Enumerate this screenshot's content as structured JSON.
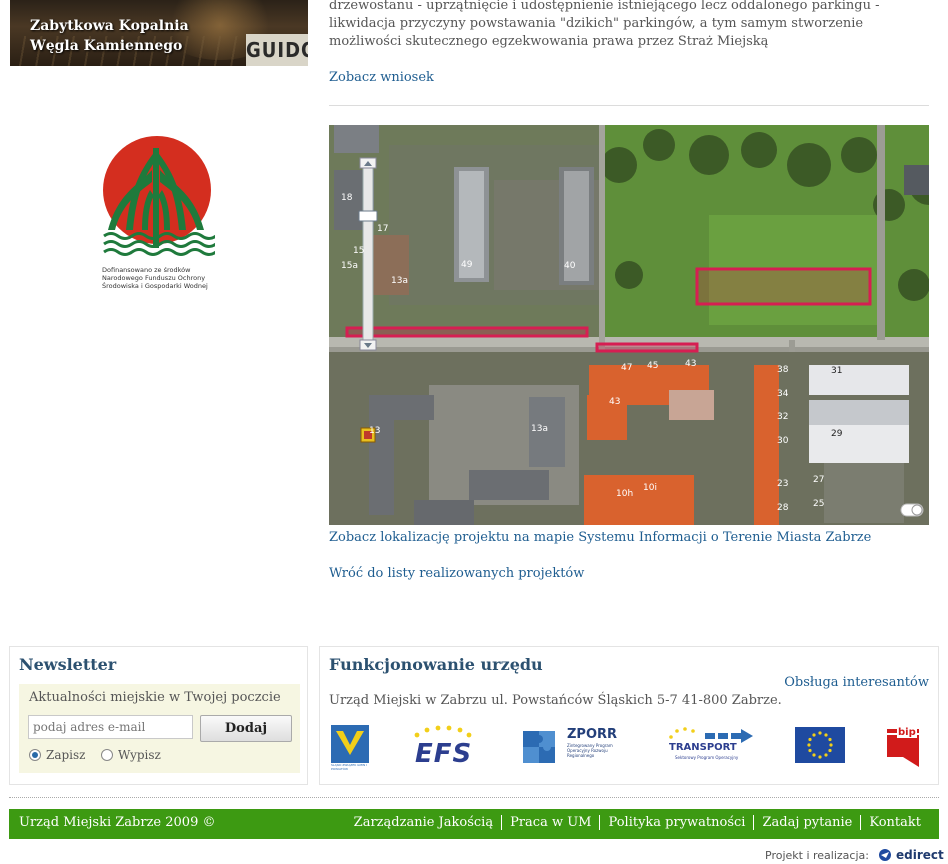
{
  "left": {
    "banner_title": "Zabytkowa Kopalnia Węgla Kamiennego",
    "banner_logo": "GUIDO",
    "nfos_caption": "Dofinansowano ze środków Narodowego Funduszu Ochrony Środowiska i Gospodarki Wodnej"
  },
  "main": {
    "intro_text": "drzewostanu - uprzątnięcie i udostępnienie istniejącego lecz oddalonego parkingu - likwidacja przyczyny powstawania \"dzikich\" parkingów, a tym samym stworzenie możliwości skutecznego egzekwowania prawa przez Straż Miejską",
    "see_request": "Zobacz wniosek",
    "map_link": "Zobacz lokalizację projektu na mapie Systemu Informacji o Terenie Miasta Zabrze",
    "back_link": "Wróć do listy realizowanych projektów",
    "map_labels": [
      "18",
      "17",
      "15",
      "15a",
      "13a",
      "49",
      "40",
      "47",
      "45",
      "43",
      "13",
      "38",
      "34",
      "32",
      "30",
      "31",
      "29",
      "27",
      "23",
      "25",
      "10h",
      "10i",
      "28",
      "43",
      "13a"
    ]
  },
  "newsletter": {
    "title": "Newsletter",
    "description": "Aktualności miejskie w Twojej poczcie",
    "email_placeholder": "podaj adres e-mail",
    "submit_label": "Dodaj",
    "subscribe_label": "Zapisz",
    "unsubscribe_label": "Wypisz"
  },
  "office": {
    "title": "Funkcjonowanie urzędu",
    "service_link": "Obsługa interesantów",
    "address": "Urząd Miejski w Zabrzu ul. Powstańców Śląskich 5-7 41-800 Zabrze.",
    "logos": {
      "silesia_caption": "ŚLĄSKI ZWIĄZEK GMIN I POWIATÓW",
      "efs": "EFS",
      "zporr": "ZPORR",
      "zporr_caption": "Zintegrowany Program Operacyjny Rozwoju Regionalnego",
      "transport": "TRANSPORT",
      "transport_caption": "Sektorowy Program Operacyjny",
      "bip": "bip"
    }
  },
  "footer": {
    "copyright": "Urząd Miejski Zabrze 2009 ©",
    "menu": [
      "Zarządzanie Jakością",
      "Praca w UM",
      "Polityka prywatności",
      "Zadaj pytanie",
      "Kontakt"
    ],
    "credit_label": "Projekt i realizacja:",
    "credit_brand": "edirect"
  },
  "colors": {
    "link": "#1e5d90",
    "heading": "#2c5170",
    "footer_bg": "#3d9a12"
  }
}
